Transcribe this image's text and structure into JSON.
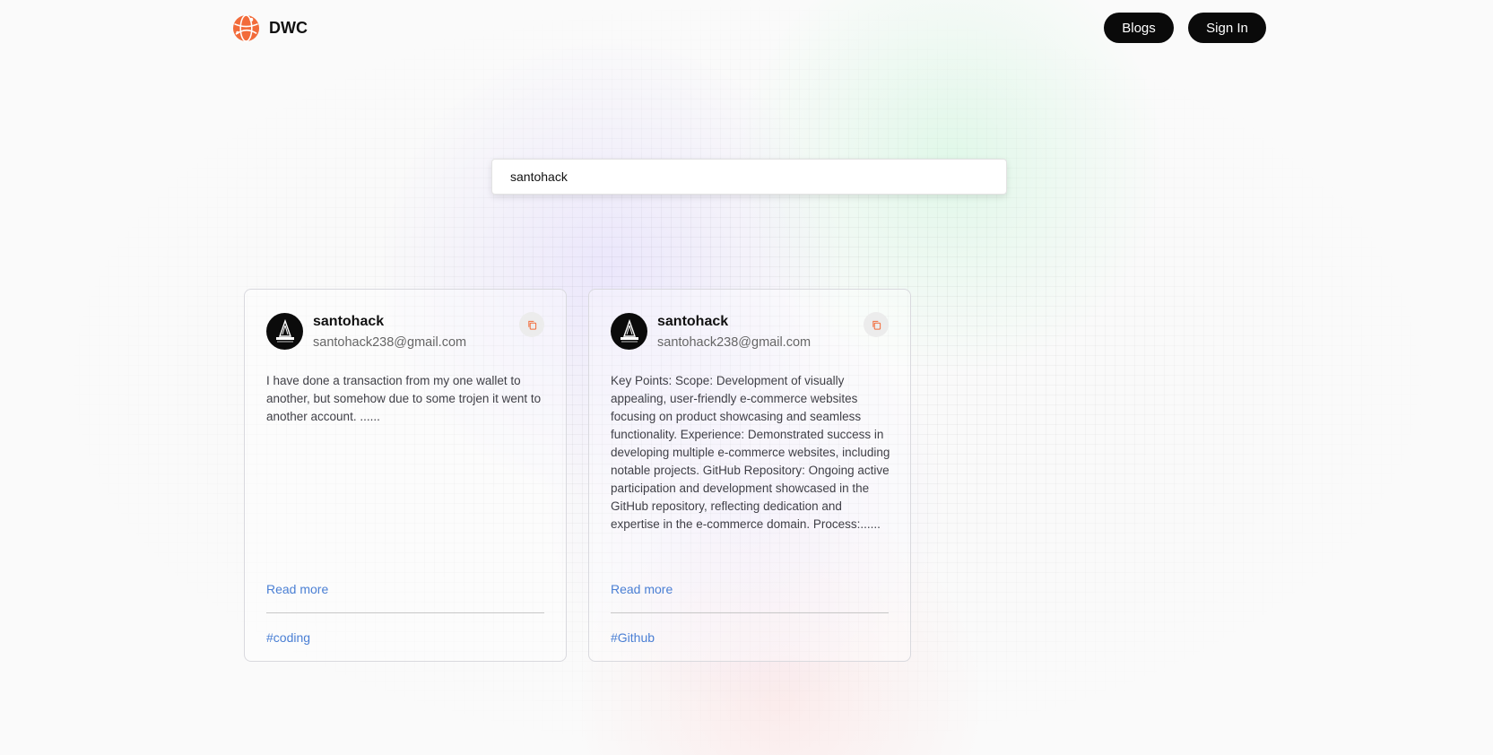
{
  "brand": {
    "name": "DWC",
    "accent": "#f26b3a"
  },
  "nav": {
    "blogs_label": "Blogs",
    "signin_label": "Sign In"
  },
  "search": {
    "value": "santohack"
  },
  "cards": [
    {
      "author": "santohack",
      "email": "santohack238@gmail.com",
      "excerpt": "I have done a transaction from my one wallet to another, but somehow due to some trojen it went to another account. ......",
      "read_more": "Read more",
      "tag": "#coding"
    },
    {
      "author": "santohack",
      "email": "santohack238@gmail.com",
      "excerpt": "Key Points: Scope: Development of visually appealing, user-friendly e-commerce websites focusing on product showcasing and seamless functionality. Experience: Demonstrated success in developing multiple e-commerce websites, including notable projects. GitHub Repository: Ongoing active participation and development showcased in the GitHub repository, reflecting dedication and expertise in the e-commerce domain. Process:......",
      "read_more": "Read more",
      "tag": "#Github"
    }
  ],
  "colors": {
    "link": "#4a7fd4",
    "nav_button_bg": "#0a0a0a",
    "copy_icon": "#f26b3a"
  },
  "icons": {
    "logo": "globe-logo-icon",
    "copy": "copy-icon",
    "avatar": "avatar-image"
  }
}
